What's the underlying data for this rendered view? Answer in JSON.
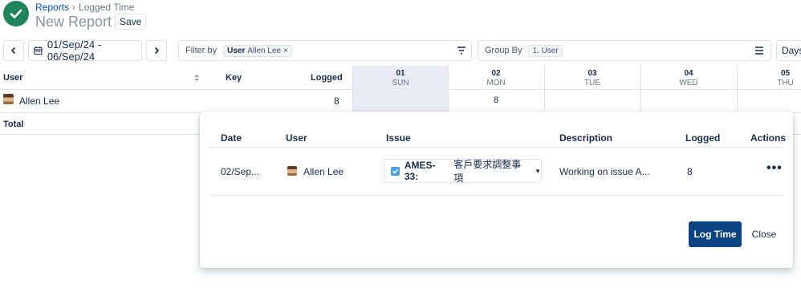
{
  "header": {
    "breadcrumbs": [
      "Reports",
      "Logged Time"
    ],
    "title": "New Report",
    "save_label": "Save"
  },
  "toolbar": {
    "date_range": "01/Sep/24 - 06/Sep/24",
    "filter_label": "Filter by",
    "filter_chip_key": "User",
    "filter_chip_value": "Allen Lee",
    "group_label": "Group By",
    "group_chip": "1. User",
    "view_mode": "Days"
  },
  "grid": {
    "col_user": "User",
    "col_key": "Key",
    "col_logged": "Logged",
    "days": [
      {
        "num": "01",
        "name": "SUN",
        "value": ""
      },
      {
        "num": "02",
        "name": "MON",
        "value": "8"
      },
      {
        "num": "03",
        "name": "TUE",
        "value": ""
      },
      {
        "num": "04",
        "name": "WED",
        "value": ""
      },
      {
        "num": "05",
        "name": "THU",
        "value": ""
      }
    ],
    "row_user": "Allen Lee",
    "row_logged": "8",
    "total_label": "Total"
  },
  "popup": {
    "headers": {
      "date": "Date",
      "user": "User",
      "issue": "Issue",
      "description": "Description",
      "logged": "Logged",
      "actions": "Actions"
    },
    "entry": {
      "date": "02/Sep...",
      "user": "Allen Lee",
      "issue_key": "AMES-33:",
      "issue_summary": "客戶要求調整事項",
      "description": "Working on issue A...",
      "logged": "8"
    },
    "log_time_label": "Log Time",
    "close_label": "Close"
  },
  "colors": {
    "accent": "#0c4382",
    "success": "#1f845a",
    "selected_day": "#e9ecf6"
  }
}
